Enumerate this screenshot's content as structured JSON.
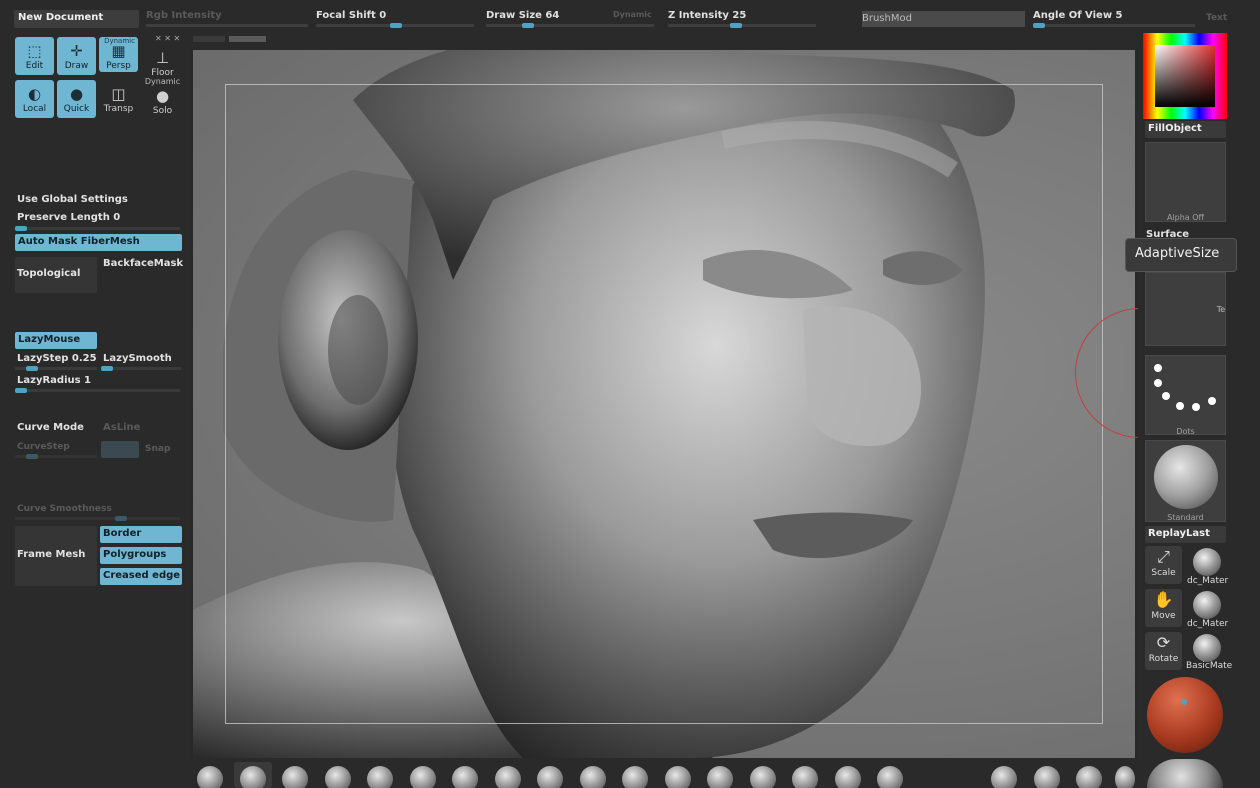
{
  "topbar": {
    "new_document": "New Document",
    "rgb_intensity": "Rgb Intensity",
    "focal_shift": "Focal Shift 0",
    "draw_size": "Draw Size 64",
    "dynamic": "Dynamic",
    "z_intensity": "Z Intensity 25",
    "brushmod": "BrushMod",
    "angle_of_view": "Angle Of View 5",
    "tex": "Text",
    "accent": "#4ea3c4"
  },
  "tools": {
    "edit": "Edit",
    "draw": "Draw",
    "persp": "Persp",
    "dynamic": "Dynamic",
    "floor": "Floor",
    "local": "Local",
    "quick": "Quick",
    "transp": "Transp",
    "dynamic2": "Dynamic",
    "solo": "Solo"
  },
  "leftpanel": {
    "use_global": "Use Global Settings",
    "preserve_length": "Preserve Length 0",
    "auto_mask": "Auto Mask FiberMesh",
    "topological": "Topological",
    "backface": "BackfaceMask",
    "lazymouse": "LazyMouse",
    "lazystep": "LazyStep 0.25",
    "lazysmooth": "LazySmooth",
    "lazyradius": "LazyRadius 1",
    "curve_mode": "Curve Mode",
    "asline": "AsLine",
    "curvestep": "CurveStep",
    "snap": "Snap",
    "curve_smoothness": "Curve Smoothness",
    "frame_mesh": "Frame Mesh",
    "border": "Border",
    "polygroups": "Polygroups",
    "creased_edge": "Creased edge"
  },
  "rightpanel": {
    "fill_object": "FillObject",
    "alpha_off": "Alpha  Off",
    "surface": "Surface",
    "texture_label": "Te",
    "dots": "Dots",
    "standard": "Standard",
    "replay_last": "ReplayLast",
    "scale": "Scale",
    "move": "Move",
    "rotate": "Rotate",
    "mat1": "dc_Mater",
    "mat2": "dc_Mater",
    "mat3": "BasicMate"
  },
  "tooltip": {
    "text": "AdaptiveSize"
  },
  "colors": {
    "active_button": "#6fb6d2",
    "brush_cursor": "#c04040",
    "main_color": "#a83a20"
  }
}
